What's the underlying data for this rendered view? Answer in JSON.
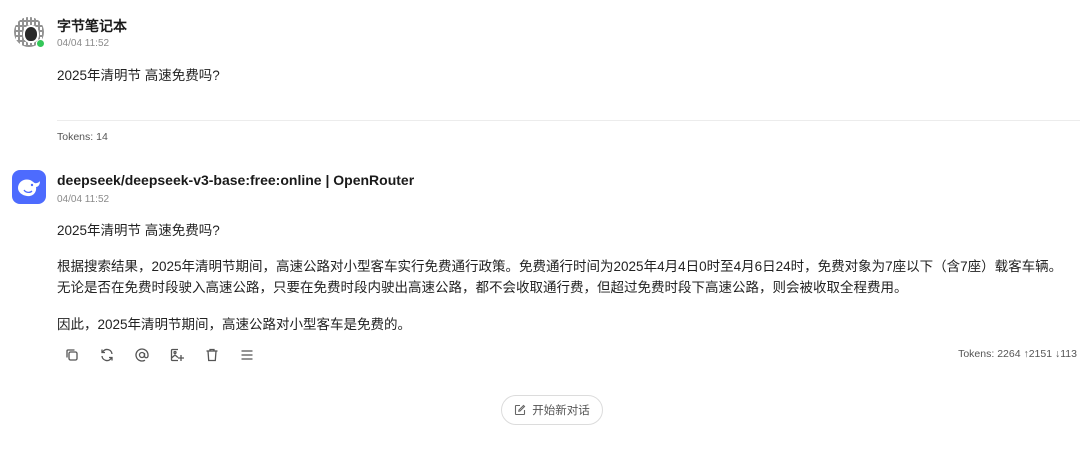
{
  "messages": [
    {
      "sender": "字节笔记本",
      "time": "04/04 11:52",
      "text": "2025年清明节 高速免费吗?",
      "avatar_icon": "qr-code-avatar",
      "tokens": "Tokens: 14"
    },
    {
      "sender": "deepseek/deepseek-v3-base:free:online | OpenRouter",
      "time": "04/04 11:52",
      "avatar_icon": "deepseek-whale-icon",
      "paragraphs": [
        "2025年清明节 高速免费吗?",
        "根据搜索结果，2025年清明节期间，高速公路对小型客车实行免费通行政策。免费通行时间为2025年4月4日0时至4月6日24时，免费对象为7座以下（含7座）载客车辆。",
        "无论是否在免费时段驶入高速公路，只要在免费时段内驶出高速公路，都不会收取通行费，但超过免费时段下高速公路，则会被收取全程费用。",
        "因此，2025年清明节期间，高速公路对小型客车是免费的。"
      ],
      "tokens": "Tokens: 2264 ↑2151 ↓113"
    }
  ],
  "toolbar": {
    "icons": [
      "copy-icon",
      "regenerate-icon",
      "mention-icon",
      "image-add-icon",
      "delete-icon",
      "more-menu-icon"
    ]
  },
  "new_chat": {
    "label": "开始新对话",
    "icon": "edit-icon"
  },
  "colors": {
    "bot_avatar": "#4d6bfe",
    "online_dot": "#34c759"
  }
}
